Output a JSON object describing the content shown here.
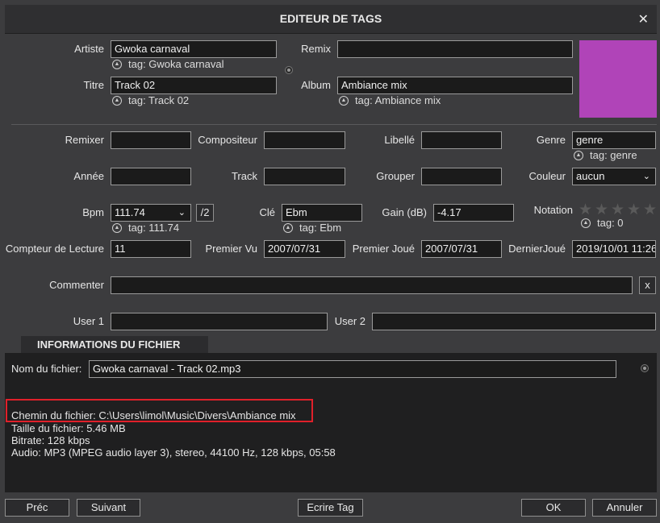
{
  "title": "EDITEUR DE TAGS",
  "close_glyph": "✕",
  "artwork_color": "#b044b8",
  "fields": {
    "artiste": {
      "label": "Artiste",
      "value": "Gwoka carnaval",
      "tag": "tag: Gwoka carnaval"
    },
    "remix": {
      "label": "Remix",
      "value": ""
    },
    "titre": {
      "label": "Titre",
      "value": "Track 02",
      "tag": "tag: Track 02"
    },
    "album": {
      "label": "Album",
      "value": "Ambiance mix",
      "tag": "tag: Ambiance mix"
    },
    "remixer": {
      "label": "Remixer",
      "value": ""
    },
    "compositeur": {
      "label": "Compositeur",
      "value": ""
    },
    "libelle": {
      "label": "Libellé",
      "value": ""
    },
    "genre": {
      "label": "Genre",
      "value": "genre",
      "tag": "tag: genre"
    },
    "annee": {
      "label": "Année",
      "value": ""
    },
    "track": {
      "label": "Track",
      "value": ""
    },
    "grouper": {
      "label": "Grouper",
      "value": ""
    },
    "couleur": {
      "label": "Couleur",
      "value": "aucun"
    },
    "bpm": {
      "label": "Bpm",
      "value": "111.74",
      "tag": "tag: 111.74",
      "half_label": "/2"
    },
    "cle": {
      "label": "Clé",
      "value": "Ebm",
      "tag": "tag: Ebm"
    },
    "gain": {
      "label": "Gain (dB)",
      "value": "-4.17"
    },
    "notation": {
      "label": "Notation",
      "tag": "tag: 0",
      "stars_filled": 0,
      "stars_total": 5
    },
    "compteur": {
      "label": "Compteur de Lecture",
      "value": "11"
    },
    "premier_vu": {
      "label": "Premier Vu",
      "value": "2007/07/31"
    },
    "premier_joue": {
      "label": "Premier Joué",
      "value": "2007/07/31"
    },
    "dernier_joue": {
      "label": "DernierJoué",
      "value": "2019/10/01 11:26"
    },
    "commenter": {
      "label": "Commenter",
      "value": "",
      "clear_label": "x"
    },
    "user1": {
      "label": "User 1",
      "value": ""
    },
    "user2": {
      "label": "User 2",
      "value": ""
    }
  },
  "file_info": {
    "tab_label": "INFORMATIONS DU FICHIER",
    "filename_label": "Nom du fichier:",
    "filename_value": "Gwoka carnaval - Track 02.mp3",
    "path_line": "Chemin du fichier: C:\\Users\\limol\\Music\\Divers\\Ambiance mix",
    "size_line": "Taille du fichier: 5.46 MB",
    "bitrate_line": "Bitrate: 128 kbps",
    "audio_line": "Audio: MP3 (MPEG audio layer 3), stereo, 44100 Hz, 128 kbps, 05:58",
    "highlight_color": "#e0202a"
  },
  "footer": {
    "prev": "Préc",
    "next": "Suivant",
    "write_tag": "Ecrire Tag",
    "ok": "OK",
    "cancel": "Annuler"
  }
}
